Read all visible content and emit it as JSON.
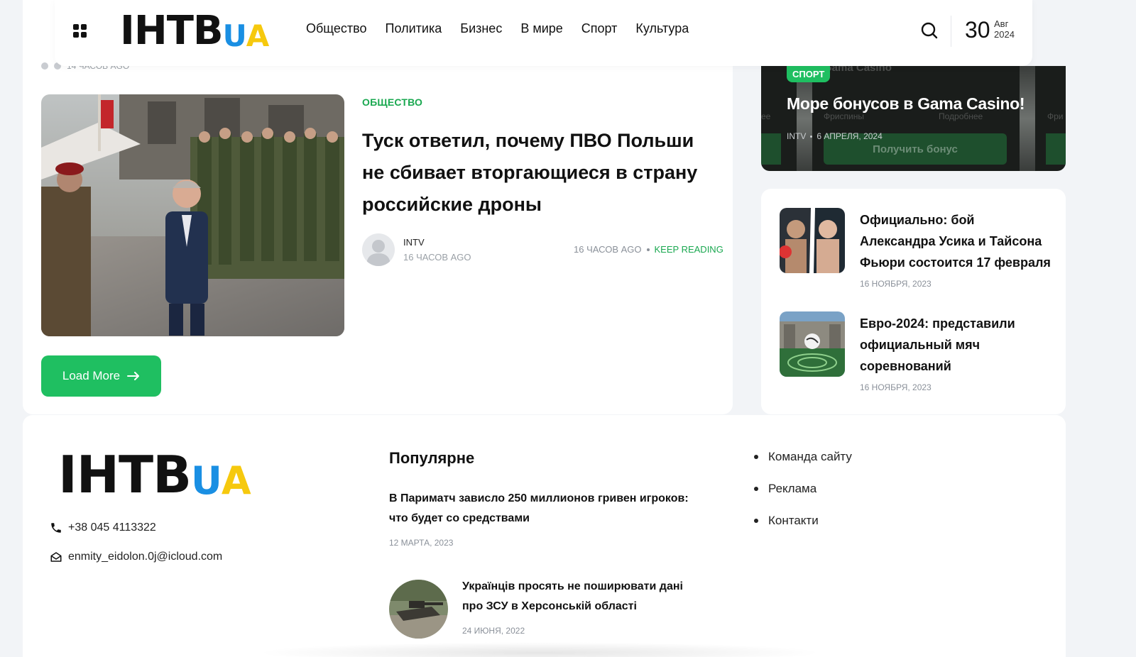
{
  "header": {
    "logo": {
      "main": "IHTB",
      "u": "U",
      "a": "A"
    },
    "nav": [
      "Общество",
      "Политика",
      "Бизнес",
      "В мире",
      "Спорт",
      "Культура"
    ],
    "date": {
      "day": "30",
      "month": "Авг",
      "year": "2024"
    }
  },
  "main": {
    "prev_meta_time": "14 ЧАСОВ AGO",
    "article": {
      "category": "ОБЩЕСТВО",
      "title": "Туск ответил, почему ПВО Польши не сбивает вторгающиеся в страну российские дроны",
      "author": "INTV",
      "author_time": "16 ЧАСОВ AGO",
      "meta_time": "16 ЧАСОВ AGO",
      "keep_reading": "KEEP READING"
    },
    "load_more": "Load More"
  },
  "promo": {
    "badge": "СПОРТ",
    "title": "Море бонусов в Gama Casino!",
    "author": "INTV",
    "date": "6 АПРЕЛЯ, 2024",
    "ghost_button": "Получить бонус",
    "ghost_left": "Фриспины",
    "ghost_right": "Подробнее",
    "ghost_top": "Gama Casino",
    "ghost_far": "Фри",
    "ghost_edge": "ee"
  },
  "side_news": [
    {
      "title": "Официально: бой Александра Усика и Тайсона Фьюри состоится 17 февраля",
      "date": "16 НОЯБРЯ, 2023"
    },
    {
      "title": "Евро-2024: представили официальный мяч соревнований",
      "date": "16 НОЯБРЯ, 2023"
    }
  ],
  "footer": {
    "logo": {
      "main": "IHTB",
      "u": "U",
      "a": "A"
    },
    "phone": "+38 045 4113322",
    "email": "enmity_eidolon.0j@icloud.com",
    "popular_title": "Популярне",
    "popular": [
      {
        "title": "В Париматч зависло 250 миллионов гривен игроков: что будет со средствами",
        "date": "12 МАРТА, 2023"
      },
      {
        "title": "Українців просять не поширювати дані про ЗСУ в Херсонській області",
        "date": "24 ИЮНЯ, 2022"
      }
    ],
    "links": [
      "Команда сайту",
      "Реклама",
      "Контакти"
    ]
  },
  "colors": {
    "accent": "#1fbf61",
    "logo_blue": "#1a8fe3",
    "logo_yellow": "#f6c90e"
  }
}
